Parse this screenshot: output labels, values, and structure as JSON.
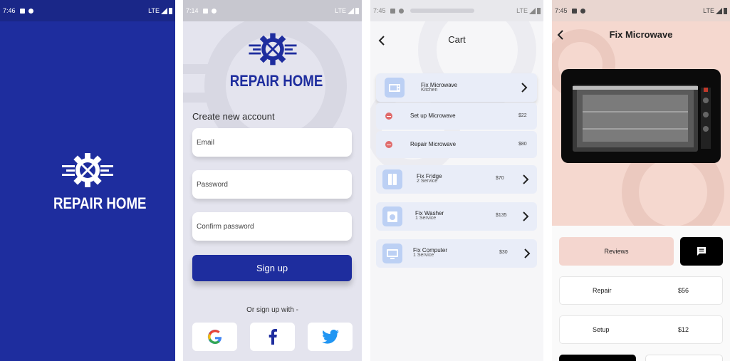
{
  "splash": {
    "status_time": "7:46",
    "status_network": "LTE",
    "brand": "REPAIR HOME"
  },
  "signup": {
    "status_time": "7:14",
    "status_network": "LTE",
    "brand": "REPAIR HOME",
    "heading": "Create new account",
    "email_label": "Email",
    "password_label": "Password",
    "confirm_label": "Confirm password",
    "signup_button": "Sign up",
    "or_text": "Or sign up with -",
    "social": [
      "google-icon",
      "facebook-icon",
      "twitter-icon"
    ]
  },
  "cart": {
    "status_time": "7:45",
    "status_network": "LTE",
    "title": "Cart",
    "main_item": {
      "name": "Fix Microwave",
      "sub": "Kitchen"
    },
    "sub_items": [
      {
        "name": "Set up Microwave",
        "price": "$22"
      },
      {
        "name": "Repair Microwave",
        "price": "$80"
      }
    ],
    "items": [
      {
        "name": "Fix Fridge",
        "sub": "2 Service",
        "price": "$70"
      },
      {
        "name": "Fix Washer",
        "sub": "1 Service",
        "price": "$135"
      },
      {
        "name": "Fix Computer",
        "sub": "1 Service",
        "price": "$30"
      }
    ]
  },
  "detail": {
    "status_time": "7:45",
    "status_network": "LTE",
    "title": "Fix Microwave",
    "reviews_button": "Reviews",
    "services": [
      {
        "name": "Repair",
        "price": "$56"
      },
      {
        "name": "Setup",
        "price": "$12"
      }
    ],
    "colors": {
      "primary": "#1e2d9e",
      "hero_bg": "#f5d8cf",
      "reviews_bg": "#f4d6cf"
    }
  }
}
